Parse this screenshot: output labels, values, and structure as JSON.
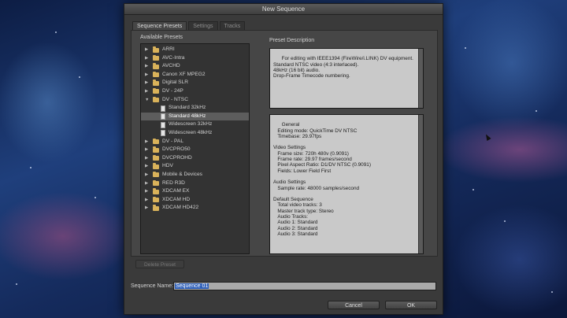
{
  "window": {
    "title": "New Sequence"
  },
  "tabs": [
    {
      "label": "Sequence Presets",
      "active": true
    },
    {
      "label": "Settings",
      "active": false
    },
    {
      "label": "Tracks",
      "active": false
    }
  ],
  "presets": {
    "heading": "Available Presets",
    "items": [
      {
        "label": "ARRI",
        "type": "folder",
        "expanded": false
      },
      {
        "label": "AVC-Intra",
        "type": "folder",
        "expanded": false
      },
      {
        "label": "AVCHD",
        "type": "folder",
        "expanded": false
      },
      {
        "label": "Canon XF MPEG2",
        "type": "folder",
        "expanded": false
      },
      {
        "label": "Digital SLR",
        "type": "folder",
        "expanded": false
      },
      {
        "label": "DV - 24P",
        "type": "folder",
        "expanded": false
      },
      {
        "label": "DV - NTSC",
        "type": "folder",
        "expanded": true
      },
      {
        "label": "Standard 32kHz",
        "type": "file"
      },
      {
        "label": "Standard 48kHz",
        "type": "file",
        "selected": true
      },
      {
        "label": "Widescreen 32kHz",
        "type": "file"
      },
      {
        "label": "Widescreen 48kHz",
        "type": "file"
      },
      {
        "label": "DV - PAL",
        "type": "folder",
        "expanded": false
      },
      {
        "label": "DVCPRO50",
        "type": "folder",
        "expanded": false
      },
      {
        "label": "DVCPROHD",
        "type": "folder",
        "expanded": false
      },
      {
        "label": "HDV",
        "type": "folder",
        "expanded": false
      },
      {
        "label": "Mobile & Devices",
        "type": "folder",
        "expanded": false
      },
      {
        "label": "RED R3D",
        "type": "folder",
        "expanded": false
      },
      {
        "label": "XDCAM EX",
        "type": "folder",
        "expanded": false
      },
      {
        "label": "XDCAM HD",
        "type": "folder",
        "expanded": false
      },
      {
        "label": "XDCAM HD422",
        "type": "folder",
        "expanded": false
      }
    ]
  },
  "description": {
    "heading": "Preset Description",
    "text": "For editing with IEEE1394 (FireWire/i.LINK) DV equipment.\nStandard NTSC video (4:3 interlaced).\n48kHz (16 bit) audio.\nDrop-Frame Timecode numbering.",
    "general": "General\n   Editing mode: QuickTime DV NTSC\n   Timebase: 29.97fps\n\nVideo Settings\n   Frame size: 720h 480v (0.9091)\n   Frame rate: 29.97 frames/second\n   Pixel Aspect Ratio: D1/DV NTSC (0.9091)\n   Fields: Lower Field First\n\nAudio Settings\n   Sample rate: 48000 samples/second\n\nDefault Sequence\n   Total video tracks: 3\n   Master track type: Stereo\n   Audio Tracks:\n   Audio 1: Standard\n   Audio 2: Standard\n   Audio 3: Standard"
  },
  "buttons": {
    "delete_preset": "Delete Preset",
    "cancel": "Cancel",
    "ok": "OK"
  },
  "sequence_name": {
    "label": "Sequence Name:",
    "value": "Sequence 01"
  }
}
